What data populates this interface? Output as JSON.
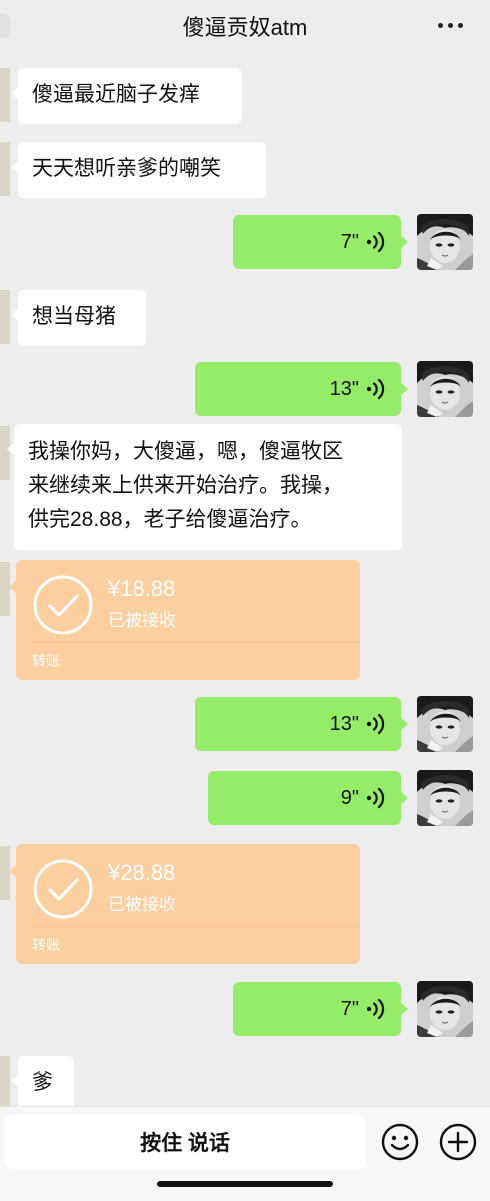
{
  "header": {
    "title": "傻逼贡奴atm"
  },
  "messages": {
    "m1": "傻逼最近脑子发痒",
    "m2": "天天想听亲爹的嘲笑",
    "v1": "7\"",
    "m3": "想当母猪",
    "v2": "13\"",
    "m4_line1": "我操你妈，大傻逼，嗯，傻逼牧区",
    "m4_line2": "来继续来上供来开始治疗。我操，",
    "m4_line3": "供完28.88，老子给傻逼治疗。",
    "t1_amount": "¥18.88",
    "t1_status": "已被接收",
    "t1_type": "转账",
    "v3": "13\"",
    "v4": "9\"",
    "t2_amount": "¥28.88",
    "t2_status": "已被接收",
    "t2_type": "转账",
    "v5": "7\"",
    "m5": "爹"
  },
  "input_bar": {
    "hold_to_talk": "按住 说话"
  },
  "colors": {
    "background": "#ededed",
    "outgoing": "#95ec69",
    "incoming": "#ffffff",
    "transfer": "#fbcf9f"
  },
  "icons": [
    "more-icon",
    "voice-wave-icon",
    "check-circle-icon",
    "emoji-icon",
    "plus-icon"
  ]
}
